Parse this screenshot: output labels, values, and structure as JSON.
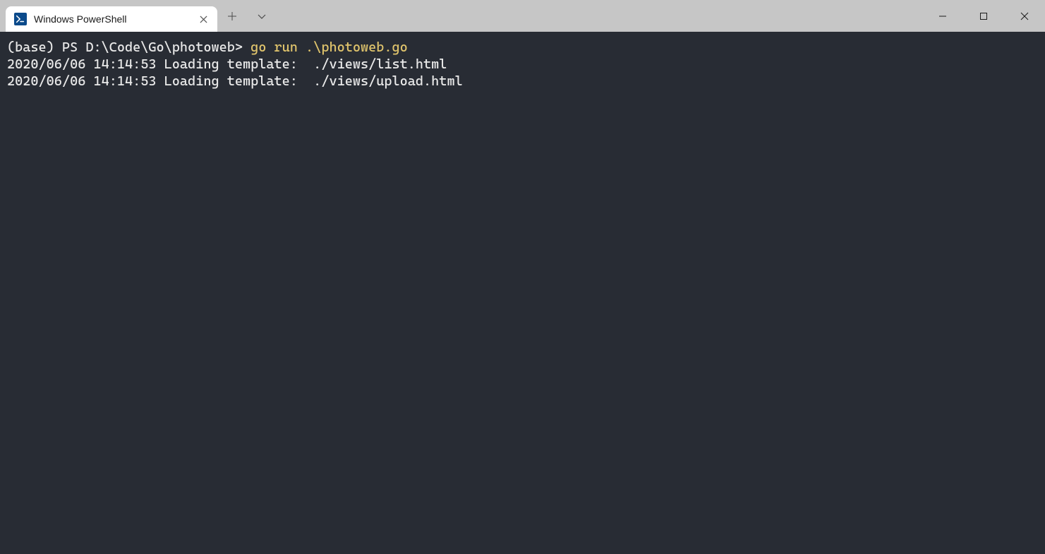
{
  "titlebar": {
    "tab": {
      "title": "Windows PowerShell",
      "icon": "powershell-icon"
    }
  },
  "terminal": {
    "prompt": "(base) PS D:\\Code\\Go\\photoweb> ",
    "command": "go run .\\photoweb.go",
    "output": [
      "2020/06/06 14:14:53 Loading template:  ./views/list.html",
      "2020/06/06 14:14:53 Loading template:  ./views/upload.html"
    ]
  },
  "colors": {
    "terminal_bg": "#282c34",
    "titlebar_bg": "#c6c6c6",
    "tab_bg": "#ffffff",
    "command_highlight": "#e0c46c",
    "text": "#e9e9e9"
  }
}
